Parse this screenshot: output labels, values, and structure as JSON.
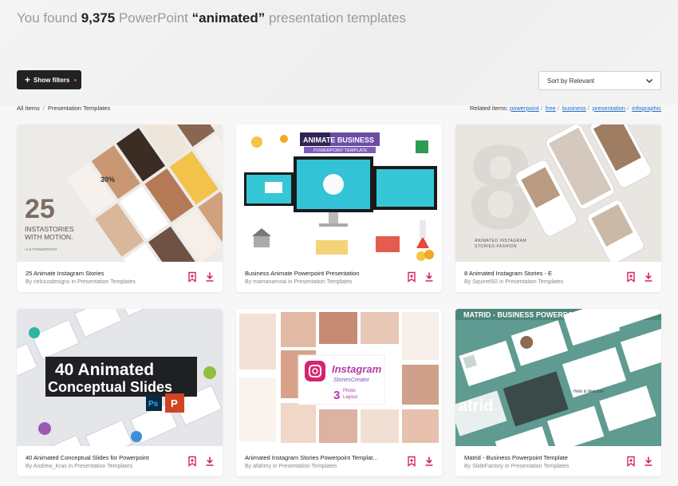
{
  "header": {
    "found_prefix": "You found",
    "count": "9,375",
    "product": "PowerPoint",
    "query": "“animated”",
    "suffix": "presentation templates"
  },
  "toolbar": {
    "filters_label": "Show filters",
    "sort_label": "Sort by Relevant"
  },
  "breadcrumb": {
    "root": "All Items",
    "sep": "/",
    "current": "Presentation Templates"
  },
  "related": {
    "label": "Related items:",
    "links": [
      "powerpoint",
      "free",
      "business",
      "presentation",
      "infographic"
    ],
    "sep": "/"
  },
  "cards": [
    {
      "title": "25 Animate Instagram Stories",
      "by": "By",
      "author": "celciusdesigns",
      "in": "in Presentation Templates",
      "thumb_text": [
        "25",
        "INSTASTORIES",
        "WITH MOTION.",
        "AI & POWERPOINT",
        "30%"
      ]
    },
    {
      "title": "Business Animate Powerpoint Presentation",
      "by": "By",
      "author": "mamanamsai",
      "in": "in Presentation Templates",
      "thumb_text": [
        "ANIMATE BUSINESS",
        "POWERPOINT TEMPLATE"
      ]
    },
    {
      "title": "8 Animated Instagram Stories - E",
      "by": "By",
      "author": "Squirrel92",
      "in": "in Presentation Templates",
      "thumb_text": [
        "8",
        "ANIMATED INSTAGRAM",
        "STORIES-FASHION"
      ]
    },
    {
      "title": "40 Animated Conceptual Slides for Powerpoint",
      "by": "By",
      "author": "Andrew_Kras",
      "in": "in Presentation Templates",
      "thumb_text": [
        "40 Animated",
        "Conceptual Slides",
        "Ps",
        "P"
      ]
    },
    {
      "title": "Animated Instagram Stories Powerpoint Templat...",
      "by": "By",
      "author": "afahmy",
      "in": "in Presentation Templates",
      "thumb_text": [
        "Instagram",
        "StoriesCreator",
        "3",
        "Photo",
        "Layout"
      ]
    },
    {
      "title": "Matrid - Business Powerpoint Template",
      "by": "By",
      "author": "SlideFactory",
      "in": "in Presentation Templates",
      "thumb_text": [
        "MATRID - BUSINESS POWERPOINT TEMPLATE",
        "atrid",
        "Hello & Welcome"
      ]
    }
  ],
  "colors": {
    "accent": "#d6245b",
    "link": "#1a6ec8",
    "dark_button": "#222222"
  }
}
